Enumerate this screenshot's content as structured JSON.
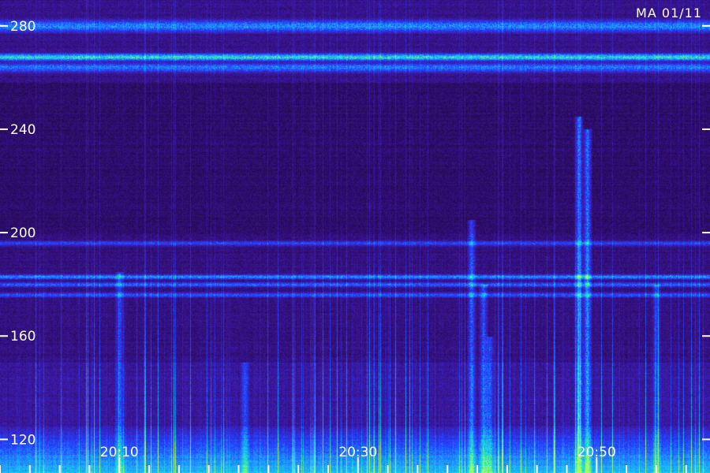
{
  "chart_data": {
    "type": "heatmap",
    "title": "MA 01/11",
    "y_ticks": [
      120,
      160,
      200,
      240,
      280
    ],
    "y_range": [
      107,
      290
    ],
    "x_ticks": [
      "20:10",
      "20:30",
      "20:50"
    ],
    "x_tick_times_min": [
      10,
      30,
      50
    ],
    "x_range_min": [
      0,
      59.5
    ],
    "colormap": [
      "#0a0318",
      "#2a0a5c",
      "#3d1aa8",
      "#2440ff",
      "#1e9bff",
      "#18e0d8",
      "#a8ff5a"
    ],
    "bands": [
      {
        "y": 280,
        "intensity": 0.5,
        "width": 5
      },
      {
        "y": 268,
        "intensity": 0.75,
        "width": 3
      },
      {
        "y": 264,
        "intensity": 0.45,
        "width": 4
      },
      {
        "y": 196,
        "intensity": 0.35,
        "width": 2
      },
      {
        "y": 183,
        "intensity": 0.55,
        "width": 2
      },
      {
        "y": 180,
        "intensity": 0.45,
        "width": 2
      },
      {
        "y": 176,
        "intensity": 0.4,
        "width": 2
      }
    ],
    "bursts": [
      {
        "t": 10,
        "top": 185,
        "intensity": 0.6
      },
      {
        "t": 20.5,
        "top": 150,
        "intensity": 0.55
      },
      {
        "t": 39.5,
        "top": 205,
        "intensity": 0.75
      },
      {
        "t": 40.5,
        "top": 180,
        "intensity": 0.7
      },
      {
        "t": 41,
        "top": 160,
        "intensity": 0.65
      },
      {
        "t": 48.5,
        "top": 245,
        "intensity": 0.95
      },
      {
        "t": 49.2,
        "top": 240,
        "intensity": 1.0
      },
      {
        "t": 55,
        "top": 180,
        "intensity": 0.55
      }
    ]
  }
}
